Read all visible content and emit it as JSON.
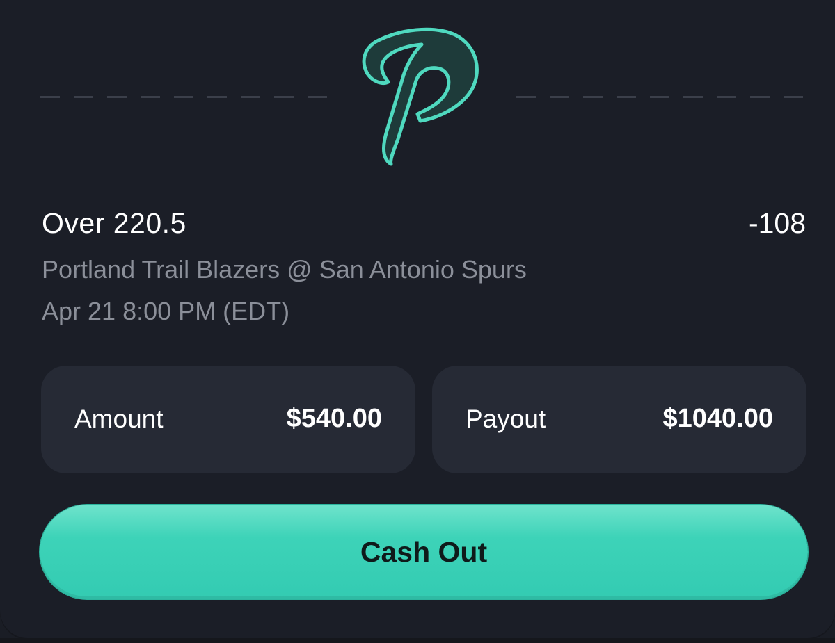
{
  "bet": {
    "title": "Over 220.5",
    "odds": "-108",
    "matchup": "Portland Trail Blazers @ San Antonio Spurs",
    "datetime": "Apr 21 8:00 PM (EDT)"
  },
  "stats": {
    "amount_label": "Amount",
    "amount_value": "$540.00",
    "payout_label": "Payout",
    "payout_value": "$1040.00"
  },
  "actions": {
    "cash_out_label": "Cash Out"
  },
  "colors": {
    "background": "#1b1e27",
    "box": "#262a35",
    "accent": "#33cbb2",
    "muted_text": "#8b8f99",
    "logo_fill": "#1e3b3a",
    "logo_stroke": "#4fd9bf"
  },
  "icons": {
    "logo": "p-logo-icon"
  }
}
